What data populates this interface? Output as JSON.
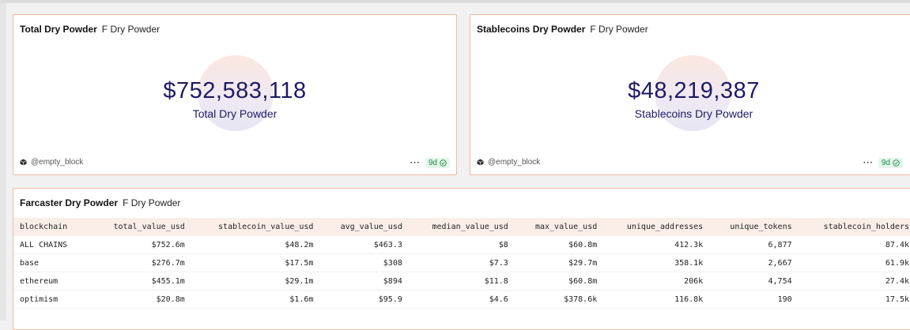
{
  "cards": [
    {
      "title": "Total Dry Powder",
      "subtitle": "F Dry Powder",
      "value": "$752,583,118",
      "label": "Total Dry Powder",
      "author": "@empty_block",
      "age": "9d"
    },
    {
      "title": "Stablecoins Dry Powder",
      "subtitle": "F Dry Powder",
      "value": "$48,219,387",
      "label": "Stablecoins Dry Powder",
      "author": "@empty_block",
      "age": "9d"
    }
  ],
  "table_card": {
    "title": "Farcaster Dry Powder",
    "subtitle": "F Dry Powder",
    "columns": [
      "blockchain",
      "total_value_usd",
      "stablecoin_value_usd",
      "avg_value_usd",
      "median_value_usd",
      "max_value_usd",
      "unique_addresses",
      "unique_tokens",
      "stablecoin_holders"
    ],
    "rows": [
      [
        "ALL CHAINS",
        "$752.6m",
        "$48.2m",
        "$463.3",
        "$8",
        "$60.8m",
        "412.3k",
        "6,877",
        "87.4k"
      ],
      [
        "base",
        "$276.7m",
        "$17.5m",
        "$308",
        "$7.3",
        "$29.7m",
        "358.1k",
        "2,667",
        "61.9k"
      ],
      [
        "ethereum",
        "$455.1m",
        "$29.1m",
        "$894",
        "$11.8",
        "$60.8m",
        "206k",
        "4,754",
        "27.4k"
      ],
      [
        "optimism",
        "$20.8m",
        "$1.6m",
        "$95.9",
        "$4.6",
        "$378.6k",
        "116.8k",
        "190",
        "17.5k"
      ]
    ]
  },
  "icons": {
    "author": "cube-icon",
    "more": "ellipsis-icon",
    "status": "check-circle-icon"
  },
  "colors": {
    "accent_border": "#efb9a4",
    "value_text": "#1e1a63",
    "badge_bg": "#e3f6ea",
    "badge_text": "#1f8a47"
  }
}
